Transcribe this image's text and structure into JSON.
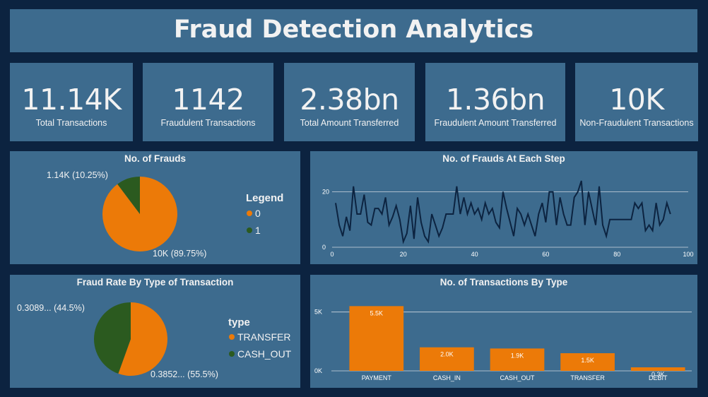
{
  "header": {
    "title": "Fraud Detection Analytics"
  },
  "kpis": [
    {
      "value": "11.14K",
      "label": "Total Transactions"
    },
    {
      "value": "1142",
      "label": "Fraudulent Transactions"
    },
    {
      "value": "2.38bn",
      "label": "Total Amount Transferred"
    },
    {
      "value": "1.36bn",
      "label": "Fraudulent Amount Transferred"
    },
    {
      "value": "10K",
      "label": "Non-Fraudulent Transactions"
    }
  ],
  "chart_data": [
    {
      "type": "pie",
      "title": "No. of Frauds",
      "legend_title": "Legend",
      "legend_position": "right",
      "slices": [
        {
          "label": "0",
          "value": 10000,
          "display": "10K (89.75%)",
          "color": "#ec7a08"
        },
        {
          "label": "1",
          "value": 1142,
          "display": "1.14K (10.25%)",
          "color": "#2b5a1f"
        }
      ]
    },
    {
      "type": "line",
      "title": "No. of Frauds At Each Step",
      "xlim": [
        0,
        100
      ],
      "ylim": [
        0,
        25
      ],
      "xticks": [
        "0",
        "20",
        "40",
        "60",
        "80",
        "100"
      ],
      "yticks": [
        "0",
        "20"
      ],
      "grid": true,
      "color": "#0c2340",
      "x": [
        1,
        2,
        3,
        4,
        5,
        6,
        7,
        8,
        9,
        10,
        11,
        12,
        13,
        14,
        15,
        16,
        17,
        18,
        19,
        20,
        21,
        22,
        23,
        24,
        25,
        26,
        27,
        28,
        29,
        30,
        31,
        32,
        33,
        34,
        35,
        36,
        37,
        38,
        39,
        40,
        41,
        42,
        43,
        44,
        45,
        46,
        47,
        48,
        49,
        50,
        51,
        52,
        53,
        54,
        55,
        56,
        57,
        58,
        59,
        60,
        61,
        62,
        63,
        64,
        65,
        66,
        67,
        68,
        69,
        70,
        71,
        72,
        73,
        74,
        75,
        76,
        77,
        78,
        79,
        80,
        81,
        82,
        83,
        84,
        85,
        86,
        87,
        88,
        89,
        90,
        91,
        92,
        93,
        94,
        95
      ],
      "y": [
        16,
        8,
        4,
        11,
        6,
        22,
        12,
        12,
        19,
        9,
        8,
        14,
        14,
        12,
        18,
        8,
        11,
        15,
        10,
        2,
        5,
        15,
        3,
        18,
        9,
        4,
        2,
        12,
        8,
        4,
        7,
        12,
        12,
        12,
        22,
        12,
        18,
        12,
        16,
        12,
        14,
        10,
        16,
        12,
        14,
        9,
        7,
        20,
        14,
        9,
        4,
        14,
        12,
        8,
        12,
        8,
        4,
        12,
        16,
        9,
        20,
        20,
        8,
        18,
        12,
        8,
        8,
        18,
        20,
        24,
        8,
        20,
        14,
        8,
        22,
        8,
        4,
        10,
        10,
        10,
        10,
        10,
        10,
        10,
        16,
        14,
        16,
        6,
        8,
        6,
        16,
        8,
        10,
        16,
        12
      ]
    },
    {
      "type": "pie",
      "title": "Fraud Rate By Type of Transaction",
      "legend_title": "type",
      "legend_position": "right",
      "slices": [
        {
          "label": "TRANSFER",
          "value": 0.3852,
          "display": "0.3852... (55.5%)",
          "color": "#ec7a08"
        },
        {
          "label": "CASH_OUT",
          "value": 0.3089,
          "display": "0.3089... (44.5%)",
          "color": "#2b5a1f"
        }
      ]
    },
    {
      "type": "bar",
      "title": "No. of Transactions By Type",
      "categories": [
        "PAYMENT",
        "CASH_IN",
        "CASH_OUT",
        "TRANSFER",
        "DEBIT"
      ],
      "values": [
        5500,
        2000,
        1900,
        1500,
        300
      ],
      "value_labels": [
        "5.5K",
        "2.0K",
        "1.9K",
        "1.5K",
        "0.3K"
      ],
      "ylim": [
        0,
        6000
      ],
      "yticks": [
        "0K",
        "5K"
      ],
      "grid": true,
      "color": "#ec7a08"
    }
  ]
}
